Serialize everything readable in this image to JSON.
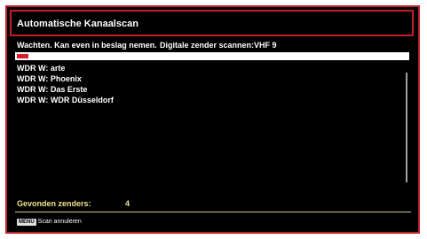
{
  "window": {
    "title": "Automatische Kanaalscan"
  },
  "status": {
    "waiting_text": "Wachten. Kan even in beslag nemen.",
    "digital_text": "Digitale zender scannen:VHF 9"
  },
  "progress": {
    "fraction": 0.03
  },
  "channels": [
    "WDR W: arte",
    "WDR W: Phoenix",
    "WDR W: Das Erste",
    "WDR W: WDR Düsseldorf"
  ],
  "summary": {
    "found_label": "Gevonden zenders:",
    "found_count": "4"
  },
  "footer": {
    "key": "MENU",
    "action": "Scan annuleren"
  },
  "colors": {
    "accent_red": "#c41e2a",
    "progress_red": "#d81e2a",
    "summary_yellow": "#f0e38c",
    "background": "#000000"
  }
}
